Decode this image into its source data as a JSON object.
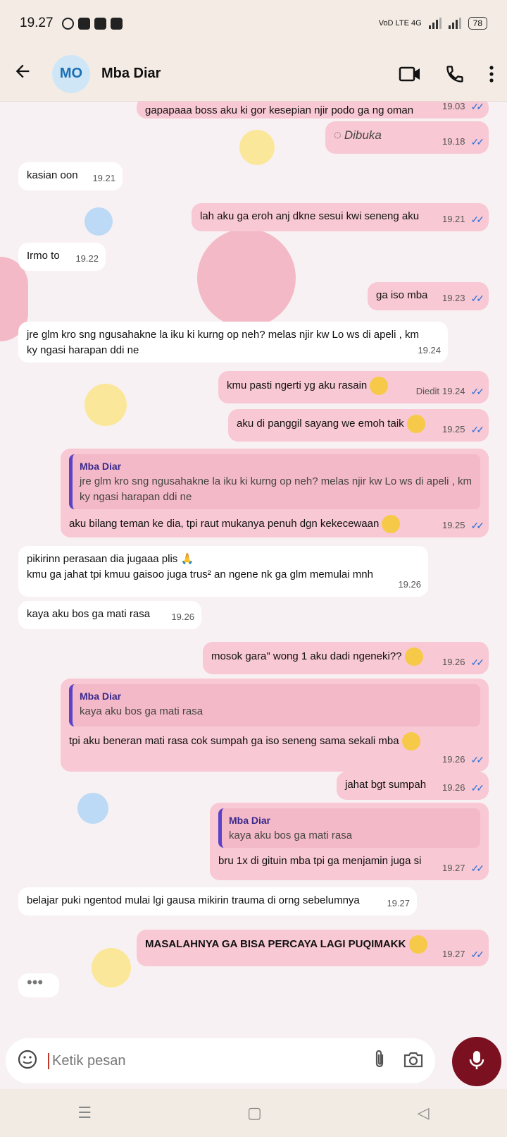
{
  "status_bar": {
    "time": "19.27",
    "network": "VoD LTE 4G",
    "battery": "78"
  },
  "header": {
    "avatar_initials": "MO",
    "contact_name": "Mba Diar"
  },
  "messages": [
    {
      "dir": "out",
      "text": "gapapaaa boss aku ki gor kesepian njir podo ga ng oman",
      "time": "19.03"
    },
    {
      "dir": "out",
      "text": "Dibuka",
      "time": "19.18"
    },
    {
      "dir": "in",
      "text": "kasian oon",
      "time": "19.21"
    },
    {
      "dir": "out",
      "text": "lah aku ga eroh anj dkne sesui kwi seneng aku",
      "time": "19.21"
    },
    {
      "dir": "in",
      "text": "Irmo to",
      "time": "19.22"
    },
    {
      "dir": "out",
      "text": "ga iso mba",
      "time": "19.23"
    },
    {
      "dir": "in",
      "text": "jre glm kro sng ngusahakne la iku ki kurng op neh? melas njir kw Lo ws di apeli , km ky ngasi harapan ddi ne",
      "time": "19.24"
    },
    {
      "dir": "out",
      "text": "kmu pasti ngerti yg aku rasain",
      "edited": "Diedit",
      "time": "19.24"
    },
    {
      "dir": "out",
      "text": "aku di panggil sayang we emoh taik",
      "time": "19.25"
    },
    {
      "dir": "out",
      "quote_name": "Mba Diar",
      "quote_text": "jre glm kro sng ngusahakne la iku ki kurng op neh? melas njir kw Lo ws di apeli , km ky ngasi harapan ddi ne",
      "text": "aku bilang teman ke dia, tpi raut mukanya penuh dgn kekecewaan",
      "time": "19.25"
    },
    {
      "dir": "in",
      "text": "pikirinn perasaan dia jugaaa plis",
      "text2": "kmu ga jahat tpi kmuu gaisoo juga trus² an ngene nk ga glm memulai mnh",
      "time": "19.26"
    },
    {
      "dir": "in",
      "text": "kaya aku bos ga mati rasa",
      "time": "19.26"
    },
    {
      "dir": "out",
      "text": "mosok gara\" wong 1 aku dadi ngeneki??",
      "time": "19.26"
    },
    {
      "dir": "out",
      "quote_name": "Mba Diar",
      "quote_text": "kaya aku bos ga mati rasa",
      "text": "tpi aku beneran mati rasa cok sumpah ga iso seneng sama sekali mba",
      "time": "19.26"
    },
    {
      "dir": "out",
      "text": "jahat bgt sumpah",
      "time": "19.26"
    },
    {
      "dir": "out",
      "quote_name": "Mba Diar",
      "quote_text": "kaya aku bos ga mati rasa",
      "text": "bru 1x di gituin mba tpi ga menjamin juga si",
      "time": "19.27"
    },
    {
      "dir": "in",
      "text": "belajar puki ngentod mulai lgi gausa mikirin trauma di orng sebelumnya",
      "time": "19.27"
    },
    {
      "dir": "out",
      "text": "MASALAHNYA GA BISA PERCAYA LAGI PUQIMAKK",
      "time": "19.27"
    }
  ],
  "typing": "•••",
  "input": {
    "placeholder": "Ketik pesan"
  },
  "navbar": {
    "menu": "☰",
    "home": "▢",
    "back": "◁"
  },
  "colors": {
    "incoming": "#ffffff",
    "outgoing": "#f8c8d4",
    "accent": "#7a1020",
    "tick": "#2a6fd6"
  }
}
